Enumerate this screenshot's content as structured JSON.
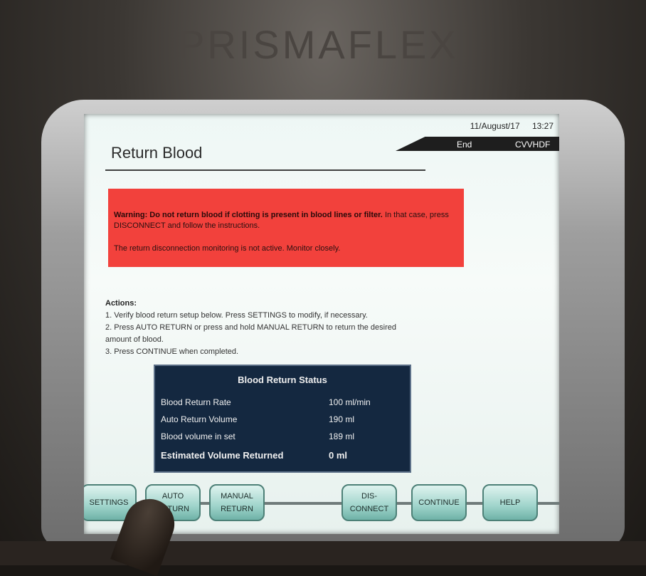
{
  "header": {
    "title": "Return Blood",
    "date": "11/August/17",
    "time": "13:27",
    "phase": "End",
    "therapy": "CVVHDF",
    "brand": "PRISMAFLEX"
  },
  "warning": {
    "line1_bold": "Warning: Do not return blood if clotting is present in blood lines or filter.",
    "line1_rest": "In that case, press DISCONNECT and follow the instructions.",
    "line2": "The return disconnection monitoring is not active. Monitor closely."
  },
  "actions": {
    "heading": "Actions:",
    "step1": "1. Verify blood return setup below. Press SETTINGS to modify, if necessary.",
    "step2a": "2. Press AUTO RETURN or press and hold MANUAL RETURN to return the desired",
    "step2b": "amount of blood.",
    "step3": "3. Press CONTINUE when completed."
  },
  "status": {
    "title": "Blood Return Status",
    "rows": [
      {
        "label": "Blood Return Rate",
        "value": "100 ml/min"
      },
      {
        "label": "Auto Return Volume",
        "value": "190 ml"
      },
      {
        "label": "Blood volume in set",
        "value": "189 ml"
      },
      {
        "label": "Estimated Volume Returned",
        "value": "0 ml"
      }
    ]
  },
  "buttons": {
    "settings": "SETTINGS",
    "auto_return": "AUTO\nRETURN",
    "auto_1": "AUTO",
    "auto_2": "RETURN",
    "manual_1": "MANUAL",
    "manual_2": "RETURN",
    "disconnect_1": "DIS-",
    "disconnect_2": "CONNECT",
    "continue": "CONTINUE",
    "help": "HELP"
  },
  "colors": {
    "warning_bg": "#f2413c",
    "status_bg": "#142840",
    "button_bg": "#9fd4cb"
  }
}
